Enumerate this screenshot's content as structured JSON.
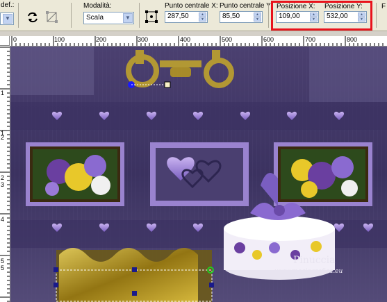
{
  "toolbar": {
    "preset_label_partial": "def.:",
    "mode_label": "Modalità:",
    "mode_value": "Scala",
    "center_x_label": "Punto centrale X:",
    "center_x_value": "287,50",
    "center_y_label": "Punto centrale Y:",
    "center_y_value": "85,50",
    "pos_x_label": "Posizione X:",
    "pos_x_value": "109,00",
    "pos_y_label": "Posizione Y:",
    "pos_y_value": "532,00",
    "partial_label": "F"
  },
  "ruler": {
    "h_ticks": [
      "0",
      "100",
      "200",
      "300",
      "400",
      "500",
      "600",
      "700",
      "800"
    ],
    "v_ticks": [
      "1",
      "1",
      "2",
      "2",
      "3",
      "4",
      "5",
      "5"
    ]
  },
  "canvas": {
    "watermark_name": "Pinuccia",
    "watermark_url": "www.magicgrafica.eu"
  },
  "colors": {
    "highlight": "#e8121b",
    "canvas_bg": "#3e3560",
    "frame_purple": "#9a83cf",
    "gold": "#c5a82a"
  }
}
